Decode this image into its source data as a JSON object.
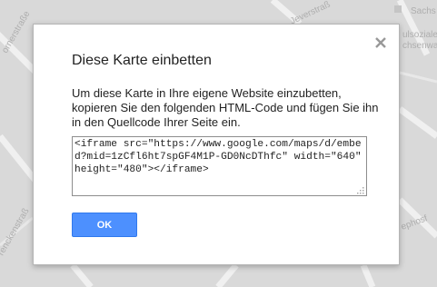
{
  "map": {
    "street_labels": [
      "Sachs",
      "Jeverstraß",
      "ulsoziale",
      "chsenwa",
      "ornerstraße",
      "renckenstraß",
      "ephosf"
    ]
  },
  "dialog": {
    "title": "Diese Karte einbetten",
    "instructions": "Um diese Karte in Ihre eigene Website einzubetten, kopieren Sie den folgenden HTML-Code und fügen Sie ihn in den Quellcode Ihrer Seite ein.",
    "embed_code": "<iframe src=\"https://www.google.com/maps/d/embed?mid=1zCfl6ht7spGF4M1P-GD0NcDThfc\" width=\"640\" height=\"480\"></iframe>",
    "ok_label": "OK",
    "close_icon": "close-icon"
  },
  "colors": {
    "map_background": "#d9d9d9",
    "button_blue": "#4d90fe"
  }
}
